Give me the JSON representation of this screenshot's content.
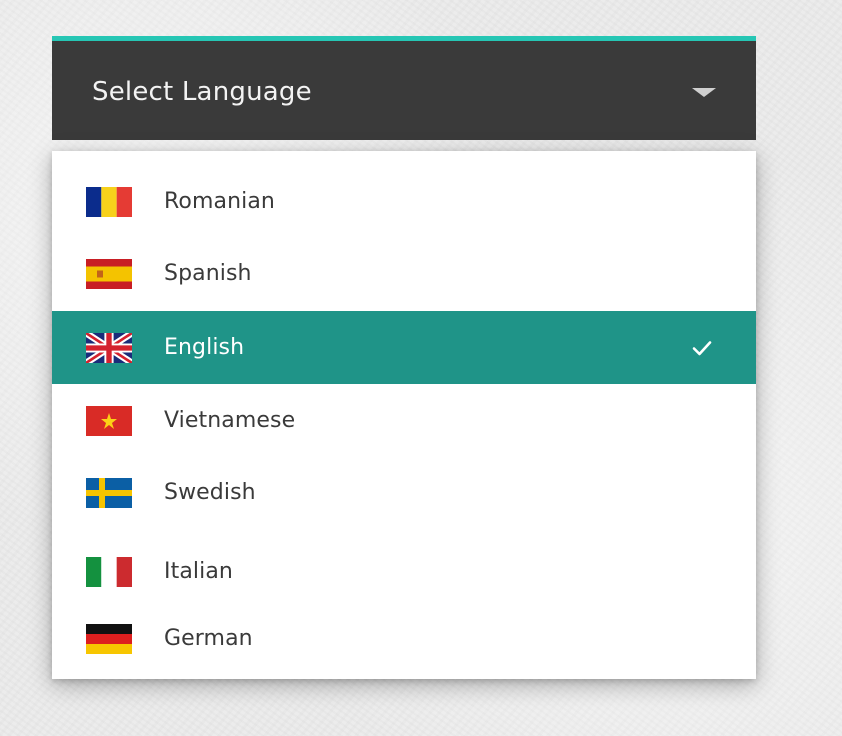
{
  "select": {
    "title": "Select Language"
  },
  "languages": [
    {
      "label": "Romanian",
      "flag": "romania-flag-icon",
      "selected": false
    },
    {
      "label": "Spanish",
      "flag": "spain-flag-icon",
      "selected": false
    },
    {
      "label": "English",
      "flag": "uk-flag-icon",
      "selected": true
    },
    {
      "label": "Vietnamese",
      "flag": "vietnam-flag-icon",
      "selected": false
    },
    {
      "label": "Swedish",
      "flag": "sweden-flag-icon",
      "selected": false
    },
    {
      "label": "Italian",
      "flag": "italy-flag-icon",
      "selected": false
    },
    {
      "label": "German",
      "flag": "germany-flag-icon",
      "selected": false
    }
  ],
  "colors": {
    "accent": "#26c6b4",
    "header_bg": "#3a3a3a",
    "selected_bg": "#1f9488"
  }
}
